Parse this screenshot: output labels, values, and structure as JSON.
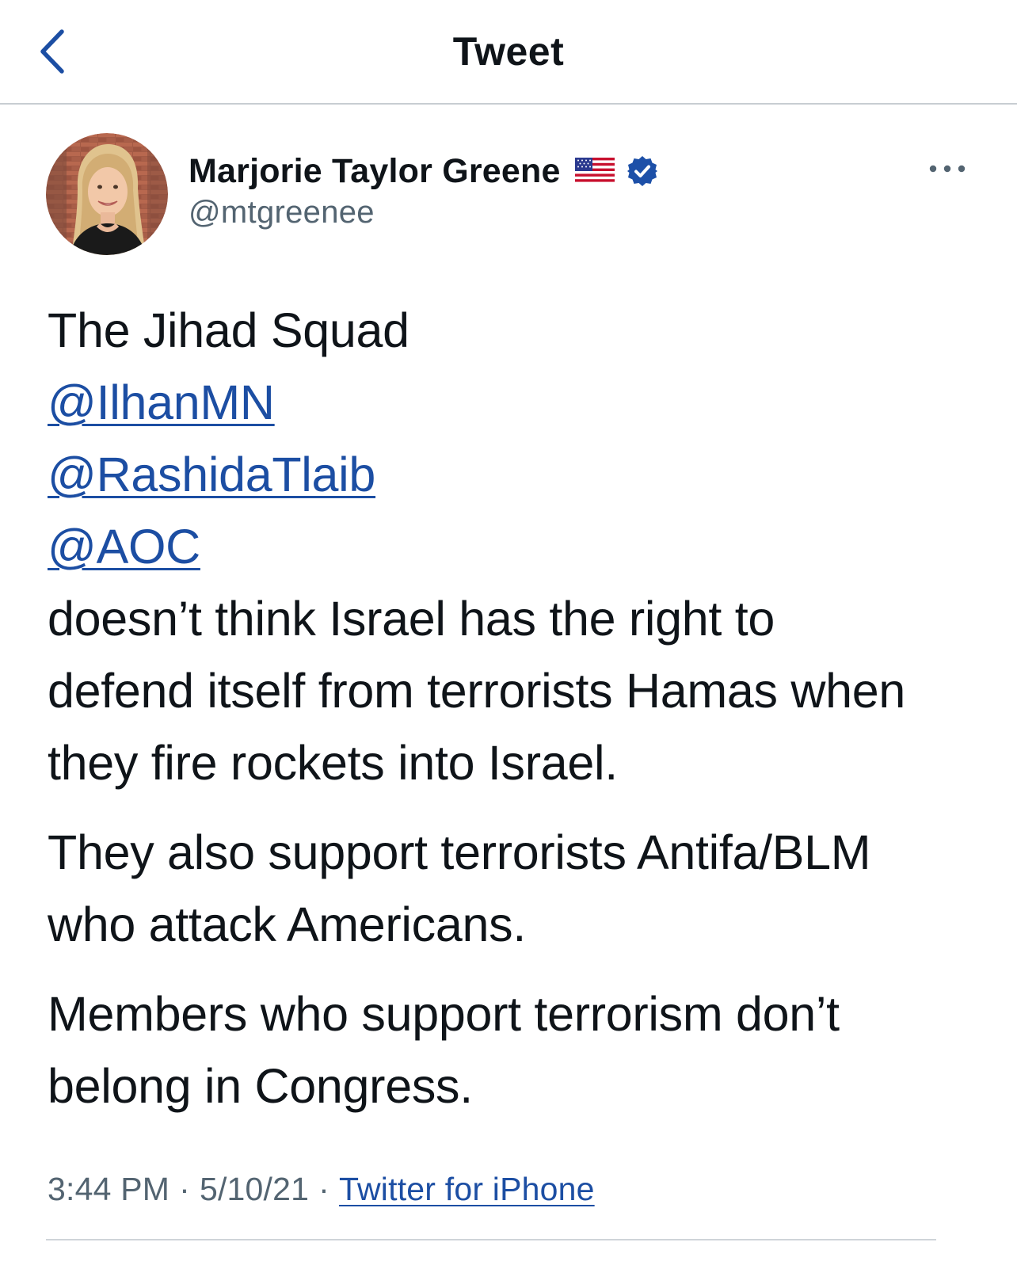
{
  "header": {
    "title": "Tweet",
    "back_icon": "chevron-left-icon"
  },
  "author": {
    "display_name": "Marjorie Taylor Greene",
    "handle": "@mtgreenee",
    "flag_emoji": "us-flag-icon",
    "verified": true
  },
  "tweet": {
    "lines": [
      "The Jihad Squad",
      "@IlhanMN",
      "@RashidaTlaib",
      "@AOC",
      "doesn’t think Israel has the right to",
      "defend itself from terrorists Hamas when",
      "they fire rockets into Israel.",
      "They also support terrorists Antifa/BLM",
      "who attack Americans.",
      "Members who support terrorism don’t",
      "belong in Congress."
    ]
  },
  "meta": {
    "time": "3:44 PM",
    "separator": "·",
    "date": "5/10/21",
    "source": "Twitter for iPhone"
  },
  "colors": {
    "link": "#1c4ea3",
    "secondary_text": "#536471",
    "primary_text": "#0f1419",
    "verified_badge": "#1d50a8"
  }
}
